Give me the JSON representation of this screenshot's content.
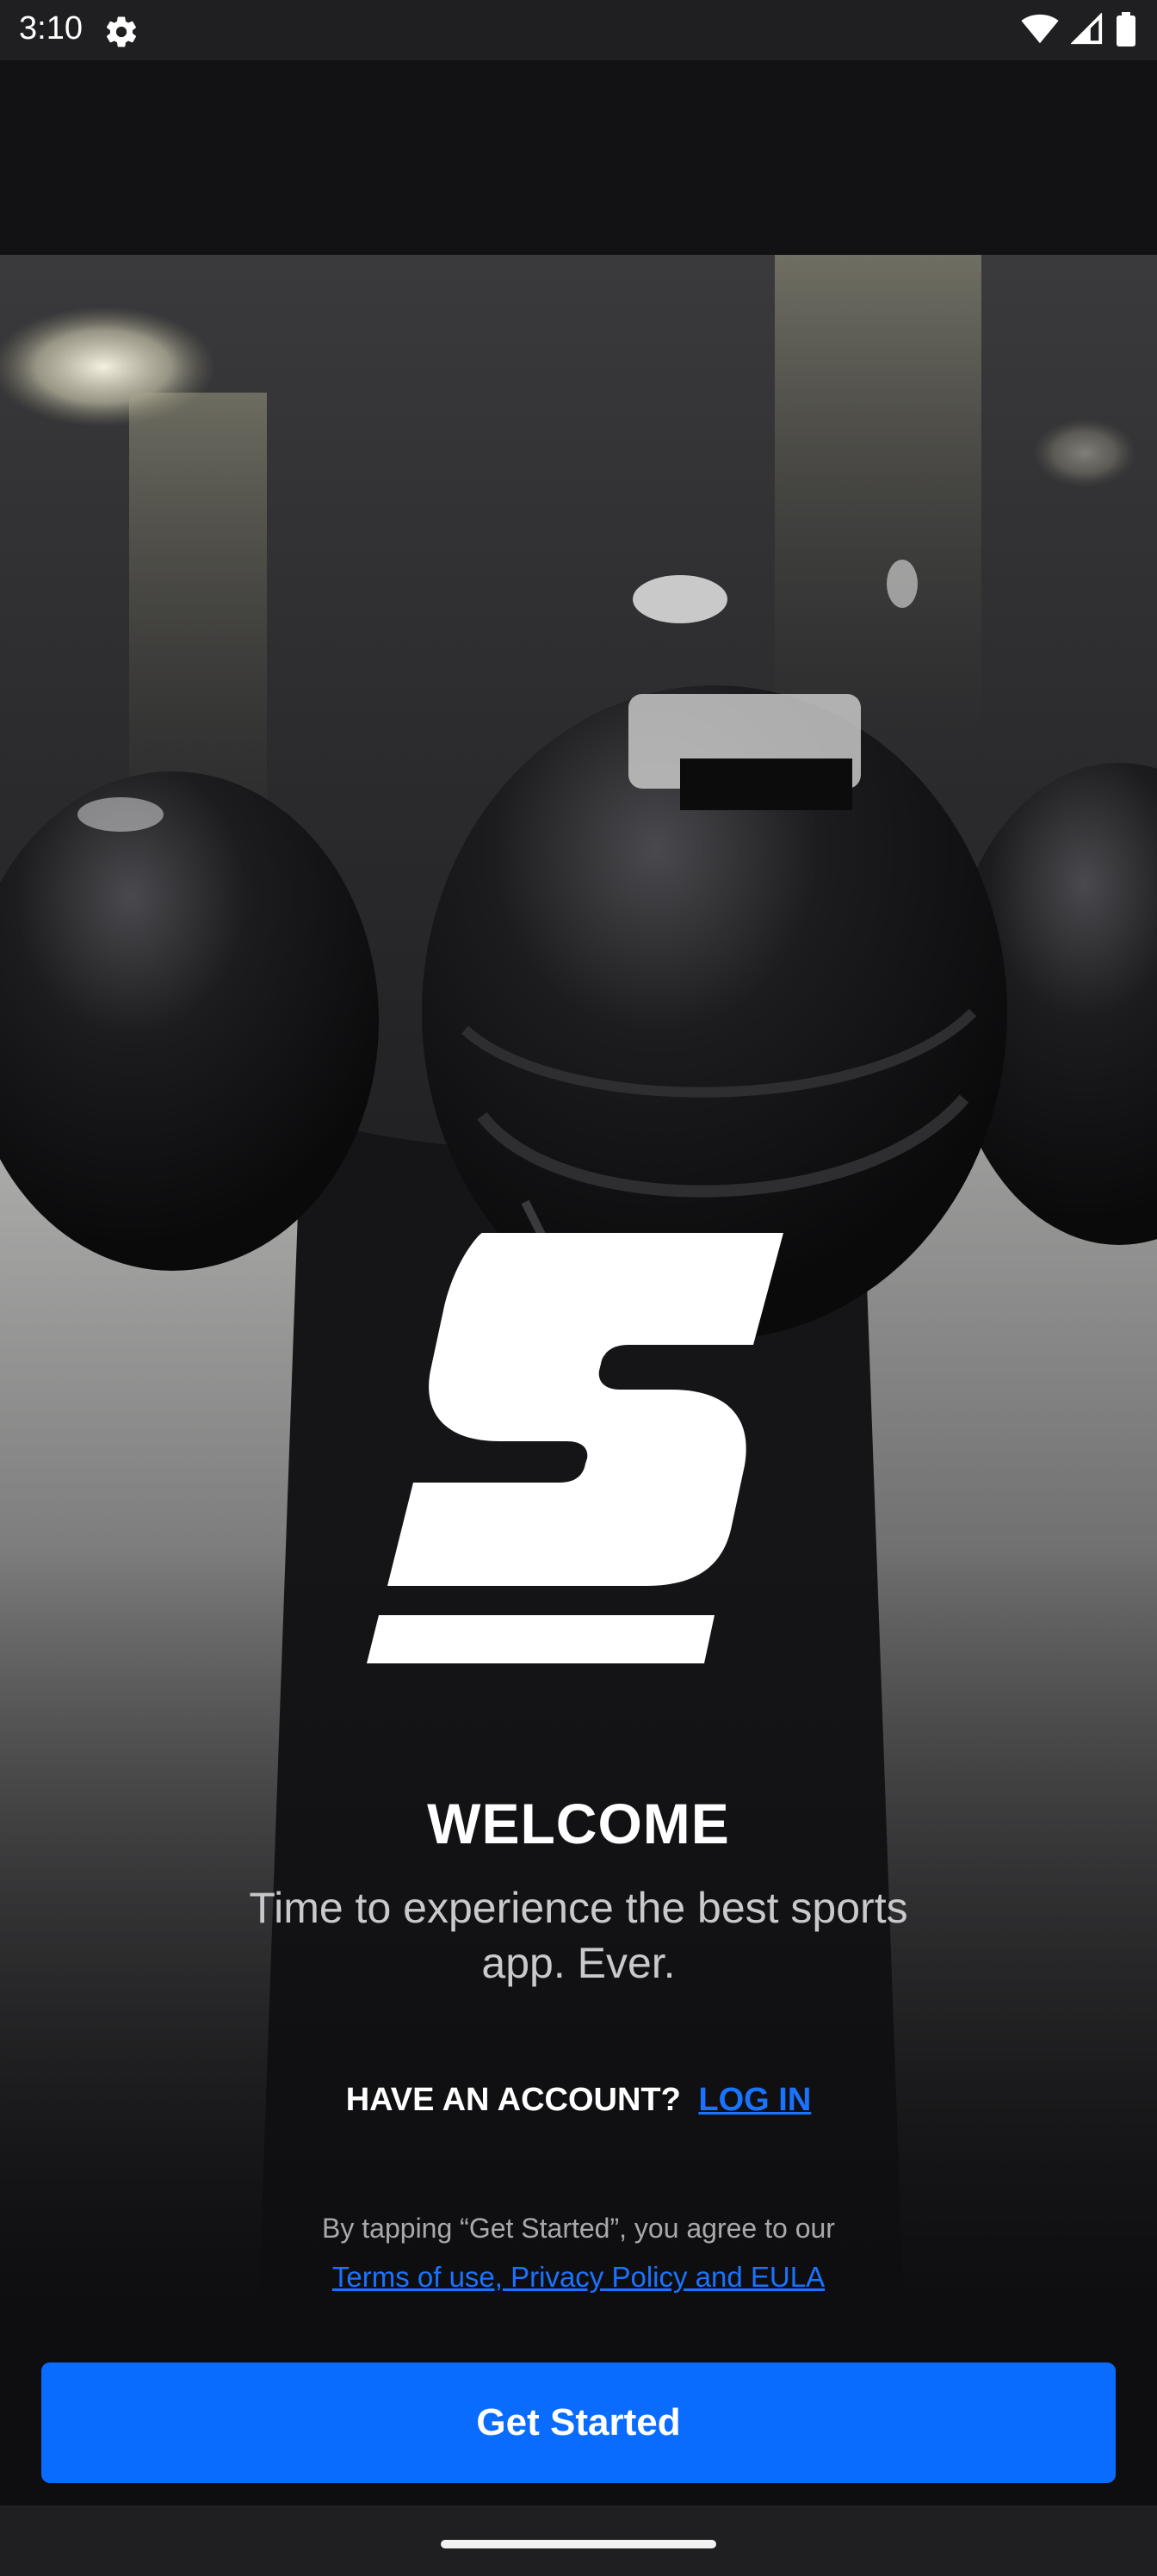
{
  "status_bar": {
    "time": "3:10",
    "icons": [
      "settings-gear-icon",
      "wifi-icon",
      "cellular-signal-icon",
      "battery-icon"
    ]
  },
  "hero": {
    "image_subject": "football players in helmets walking through tunnel",
    "logo_icon": "brand-s-logo-icon"
  },
  "welcome": {
    "title": "WELCOME",
    "tagline": "Time to experience the best sports app. Ever."
  },
  "account": {
    "question": "HAVE AN ACCOUNT?",
    "login_label": "LOG IN"
  },
  "terms": {
    "text": "By tapping “Get Started”, you agree to our",
    "link": "Terms of use, Privacy Policy and EULA"
  },
  "cta": {
    "label": "Get Started"
  },
  "colors": {
    "accent": "#0a6cff",
    "link": "#1a73ff",
    "background": "#111113"
  }
}
